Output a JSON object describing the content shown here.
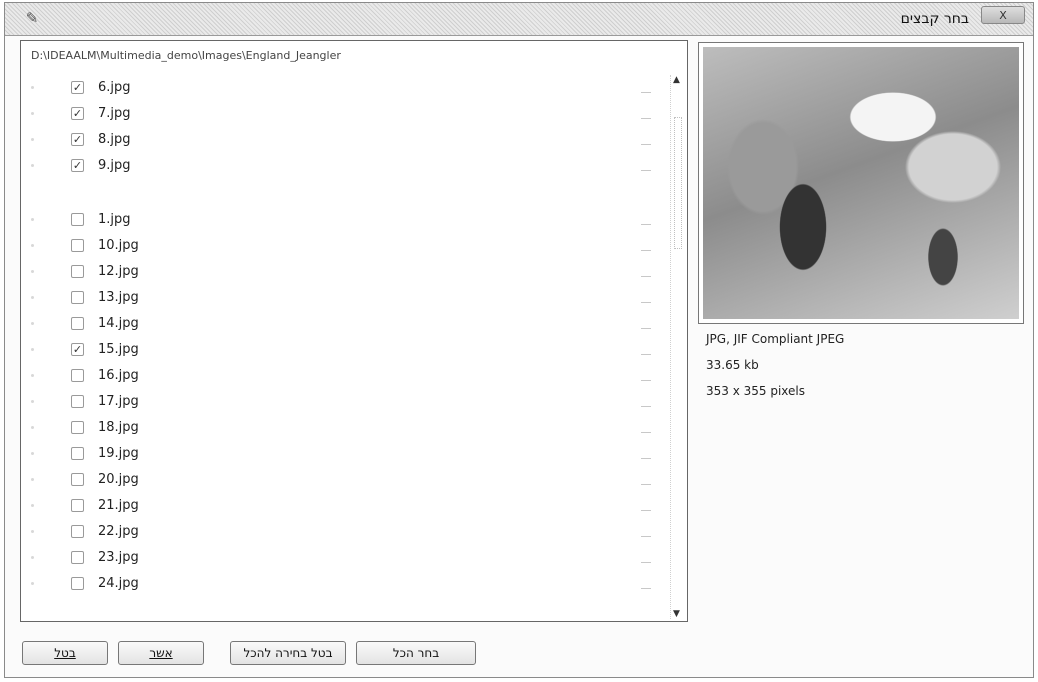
{
  "window": {
    "title": "בחר קבצים",
    "close_label": "X"
  },
  "file_panel": {
    "path": "D:\\IDEAALM\\Multimedia_demo\\Images\\England_Jeangler",
    "files": [
      {
        "name": "6.jpg",
        "checked": true
      },
      {
        "name": "7.jpg",
        "checked": true
      },
      {
        "name": "8.jpg",
        "checked": true
      },
      {
        "name": "9.jpg",
        "checked": true
      },
      {
        "name": "1.jpg",
        "checked": false
      },
      {
        "name": "10.jpg",
        "checked": false
      },
      {
        "name": "12.jpg",
        "checked": false
      },
      {
        "name": "13.jpg",
        "checked": false
      },
      {
        "name": "14.jpg",
        "checked": false
      },
      {
        "name": "15.jpg",
        "checked": true
      },
      {
        "name": "16.jpg",
        "checked": false
      },
      {
        "name": "17.jpg",
        "checked": false
      },
      {
        "name": "18.jpg",
        "checked": false
      },
      {
        "name": "19.jpg",
        "checked": false
      },
      {
        "name": "20.jpg",
        "checked": false
      },
      {
        "name": "21.jpg",
        "checked": false
      },
      {
        "name": "22.jpg",
        "checked": false
      },
      {
        "name": "23.jpg",
        "checked": false
      },
      {
        "name": "24.jpg",
        "checked": false
      }
    ]
  },
  "preview": {
    "format": "JPG, JIF Compliant JPEG",
    "size": "33.65 kb",
    "dimensions": "353 x 355 pixels"
  },
  "buttons": {
    "cancel": "בטל",
    "confirm": "אשר",
    "deselect_all": "בטל בחירה להכל",
    "select_all": "בחר הכל"
  },
  "icons": {
    "app": "app-icon",
    "check": "✓"
  }
}
